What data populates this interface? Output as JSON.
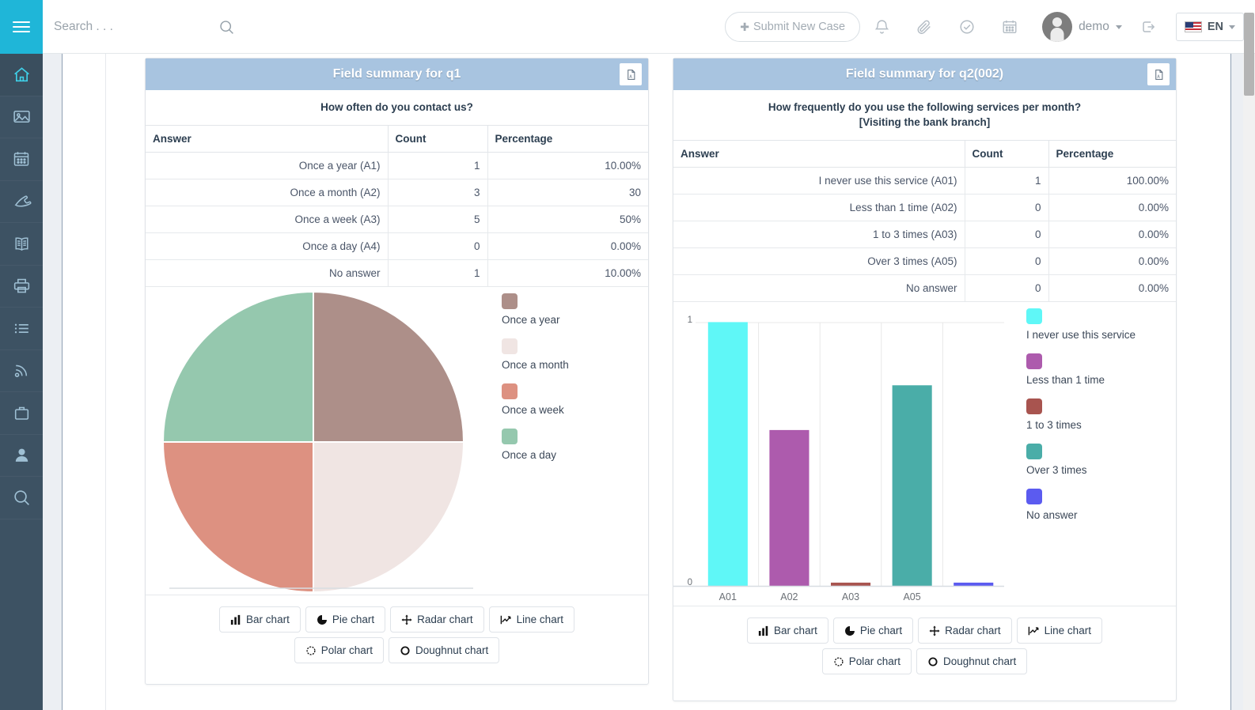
{
  "topbar": {
    "menu_icon": "hamburger-icon",
    "search_placeholder": "Search . . .",
    "search_value": "",
    "search_icon": "search-icon",
    "submit_case_label": "Submit New Case",
    "icons": [
      "bell-icon",
      "paperclip-icon",
      "check-circle-icon",
      "calendar-icon"
    ],
    "user_name": "demo",
    "logout_icon": "logout-icon",
    "language": "EN",
    "flag_icon": "us-flag-icon"
  },
  "sidebar": {
    "items": [
      {
        "name": "home-icon",
        "active": true
      },
      {
        "name": "image-icon",
        "active": false
      },
      {
        "name": "calendar-icon",
        "active": false
      },
      {
        "name": "phone-icon",
        "active": false
      },
      {
        "name": "book-icon",
        "active": false
      },
      {
        "name": "printer-icon",
        "active": false
      },
      {
        "name": "list-icon",
        "active": false
      },
      {
        "name": "rss-icon",
        "active": false
      },
      {
        "name": "briefcase-icon",
        "active": false
      },
      {
        "name": "user-icon",
        "active": false
      },
      {
        "name": "search-icon",
        "active": false
      }
    ]
  },
  "chart_buttons": [
    "Bar chart",
    "Pie chart",
    "Radar chart",
    "Line chart",
    "Polar chart",
    "Doughnut chart"
  ],
  "panels": [
    {
      "title": "Field summary for q1",
      "export_icon": "export-file-icon",
      "question": "How often do you contact us?",
      "columns": [
        "Answer",
        "Count",
        "Percentage"
      ],
      "rows": [
        {
          "answer": "Once a year (A1)",
          "count": "1",
          "percentage": "10.00%"
        },
        {
          "answer": "Once a month (A2)",
          "count": "3",
          "percentage": "30"
        },
        {
          "answer": "Once a week (A3)",
          "count": "5",
          "percentage": "50%"
        },
        {
          "answer": "Once a day (A4)",
          "count": "0",
          "percentage": "0.00%"
        },
        {
          "answer": "No answer",
          "count": "1",
          "percentage": "10.00%"
        }
      ]
    },
    {
      "title": "Field summary for q2(002)",
      "export_icon": "export-file-icon",
      "question": "How frequently do you use the following services per month?\n[Visiting the bank branch]",
      "columns": [
        "Answer",
        "Count",
        "Percentage"
      ],
      "rows": [
        {
          "answer": "I never use this service (A01)",
          "count": "1",
          "percentage": "100.00%"
        },
        {
          "answer": "Less than 1 time (A02)",
          "count": "0",
          "percentage": "0.00%"
        },
        {
          "answer": "1 to 3 times (A03)",
          "count": "0",
          "percentage": "0.00%"
        },
        {
          "answer": "Over 3 times (A05)",
          "count": "0",
          "percentage": "0.00%"
        },
        {
          "answer": "No answer",
          "count": "0",
          "percentage": "0.00%"
        }
      ]
    }
  ],
  "chart_data": [
    {
      "type": "pie",
      "title": "",
      "legend_position": "right",
      "labels": [
        "Once a year",
        "Once a month",
        "Once a week",
        "Once a day"
      ],
      "values": [
        1,
        1,
        1,
        1
      ],
      "colors": [
        "#ad8f89",
        "#f0e5e3",
        "#dd9181",
        "#95c8ae"
      ]
    },
    {
      "type": "bar",
      "title": "",
      "legend_position": "right",
      "categories": [
        "A01",
        "A02",
        "A03",
        "A05",
        ""
      ],
      "labels": [
        "I never use this service",
        "Less than 1 time",
        "1 to 3 times",
        "Over 3 times",
        "No answer"
      ],
      "values": [
        1,
        0.59,
        0.006,
        0.76,
        0.004
      ],
      "colors": [
        "#5ff7f7",
        "#ad5bad",
        "#a8544f",
        "#4aada8",
        "#5b5bf0"
      ],
      "ylim": [
        0,
        1
      ],
      "yticks": [
        "0",
        "1"
      ],
      "xlabel": "",
      "ylabel": "",
      "grid": true
    }
  ]
}
